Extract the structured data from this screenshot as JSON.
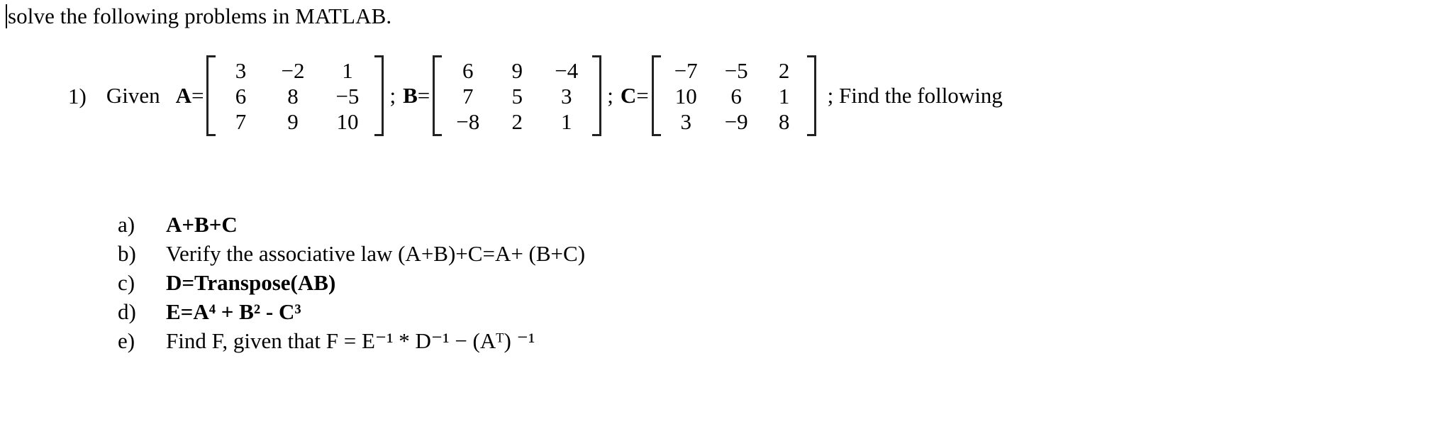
{
  "document": {
    "intro_line": "solve the following problems in MATLAB.",
    "problem": {
      "number": "1)",
      "given_label": "Given",
      "equals": "=",
      "separator": ";",
      "tail": "; Find the following",
      "matrices": [
        {
          "name": "A",
          "rows": [
            [
              "3",
              "−2",
              "1"
            ],
            [
              "6",
              "8",
              "−5"
            ],
            [
              "7",
              "9",
              "10"
            ]
          ]
        },
        {
          "name": "B",
          "rows": [
            [
              "6",
              "9",
              "−4"
            ],
            [
              "7",
              "5",
              "3"
            ],
            [
              "−8",
              "2",
              "1"
            ]
          ]
        },
        {
          "name": "C",
          "rows": [
            [
              "−7",
              "−5",
              "2"
            ],
            [
              "10",
              "6",
              "1"
            ],
            [
              "3",
              "−9",
              "8"
            ]
          ]
        }
      ]
    },
    "sub_items": [
      {
        "marker": "a)",
        "text": "A+B+C"
      },
      {
        "marker": "b)",
        "text": "Verify the associative law (A+B)+C=A+ (B+C)"
      },
      {
        "marker": "c)",
        "text": "D=Transpose(AB)"
      },
      {
        "marker": "d)",
        "text": "E=A⁴ + B² - C³"
      },
      {
        "marker": "e)",
        "text": "Find F, given that  F = E⁻¹ * D⁻¹  − (Aᵀ) ⁻¹"
      }
    ]
  },
  "colors": {
    "page_background": "#ffffff",
    "text": "#000000",
    "bracket": "#222222"
  }
}
